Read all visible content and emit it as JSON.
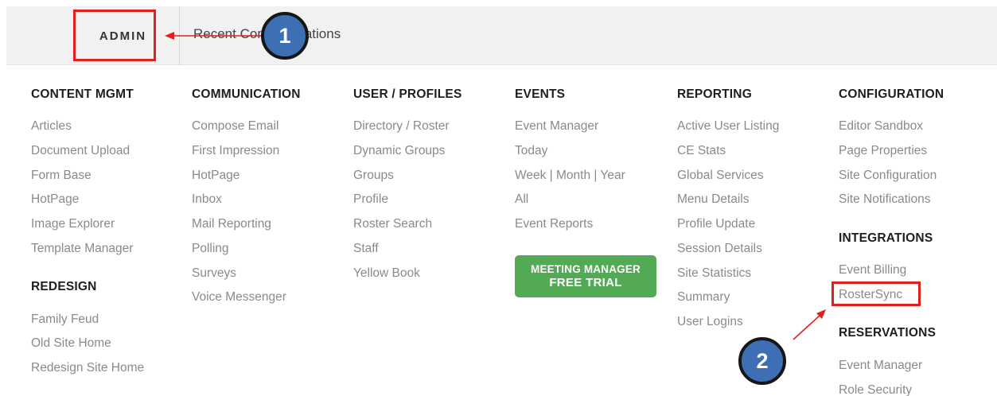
{
  "tabs": {
    "admin_label": "ADMIN",
    "recent_label": "Recent Communications"
  },
  "menu": {
    "content_mgmt": {
      "heading": "CONTENT MGMT",
      "items": [
        "Articles",
        "Document Upload",
        "Form Base",
        "HotPage",
        "Image Explorer",
        "Template Manager"
      ]
    },
    "redesign": {
      "heading": "REDESIGN",
      "items": [
        "Family Feud",
        "Old Site Home",
        "Redesign Site Home"
      ]
    },
    "communication": {
      "heading": "COMMUNICATION",
      "items": [
        "Compose Email",
        "First Impression",
        "HotPage",
        "Inbox",
        "Mail Reporting",
        "Polling",
        "Surveys",
        "Voice Messenger"
      ]
    },
    "user_profiles": {
      "heading": "USER / PROFILES",
      "items": [
        "Directory / Roster",
        "Dynamic Groups",
        "Groups",
        "Profile",
        "Roster Search",
        "Staff",
        "Yellow Book"
      ]
    },
    "events": {
      "heading": "EVENTS",
      "items": [
        "Event Manager",
        "Today",
        "Week | Month | Year",
        "All",
        "Event Reports"
      ]
    },
    "reporting": {
      "heading": "REPORTING",
      "items": [
        "Active User Listing",
        "CE Stats",
        "Global Services",
        "Menu Details",
        "Profile Update",
        "Session Details",
        "Site Statistics",
        "Summary",
        "User Logins"
      ]
    },
    "configuration": {
      "heading": "CONFIGURATION",
      "items": [
        "Editor Sandbox",
        "Page Properties",
        "Site Configuration",
        "Site Notifications"
      ]
    },
    "integrations": {
      "heading": "INTEGRATIONS",
      "items": [
        "Event Billing",
        "RosterSync"
      ]
    },
    "reservations": {
      "heading": "RESERVATIONS",
      "items": [
        "Event Manager",
        "Role Security"
      ]
    }
  },
  "trial_button": {
    "line1": "MEETING MANAGER",
    "line2": "FREE TRIAL"
  },
  "annotations": {
    "step1": "1",
    "step2": "2",
    "highlight_color": "#e0201f",
    "badge_color": "#3e6fb4"
  }
}
